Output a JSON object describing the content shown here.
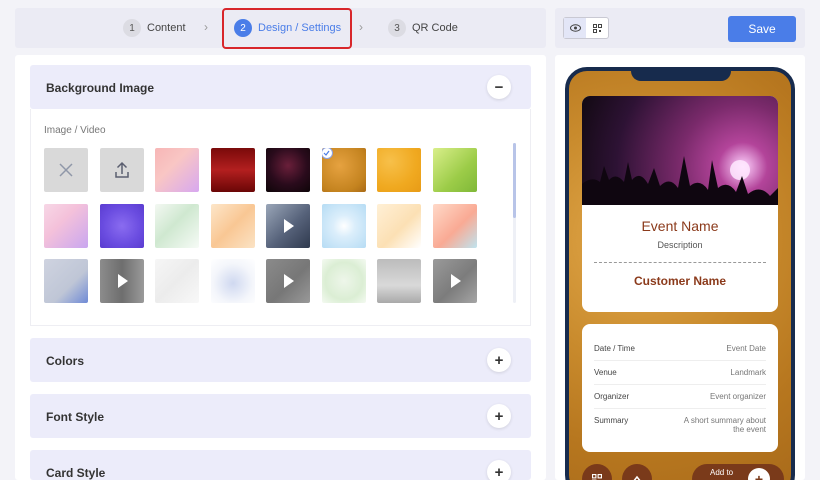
{
  "stepper": {
    "steps": [
      {
        "num": "1",
        "label": "Content"
      },
      {
        "num": "2",
        "label": "Design / Settings"
      },
      {
        "num": "3",
        "label": "QR Code"
      }
    ]
  },
  "panels": {
    "background_image": {
      "title": "Background Image",
      "toggle": "−",
      "sub_label": "Image / Video"
    },
    "colors": {
      "title": "Colors",
      "toggle": "+"
    },
    "font_style": {
      "title": "Font Style",
      "toggle": "+"
    },
    "card_style": {
      "title": "Card Style",
      "toggle": "+"
    }
  },
  "thumbnails": [
    {
      "kind": "none",
      "bg": "#d9d9d9"
    },
    {
      "kind": "upload",
      "bg": "#d9d9d9"
    },
    {
      "kind": "image",
      "bg": "linear-gradient(135deg,#f7b6b6,#f9c6c4 40%,#d7a8f0)"
    },
    {
      "kind": "image",
      "bg": "linear-gradient(180deg,#7a0a0a,#b31f1f 50%,#6a0606)"
    },
    {
      "kind": "image",
      "bg": "radial-gradient(circle at 50% 40%,#6a1f3a,#2a0b1c 55%,#0e0508)"
    },
    {
      "kind": "image",
      "bg": "radial-gradient(circle at 40% 40%,#e6a240,#c4831f 70%,#a96a16)",
      "selected": true
    },
    {
      "kind": "image",
      "bg": "radial-gradient(circle at 30% 30%,#f7c04a,#f0a920 60%,#e89b16)"
    },
    {
      "kind": "image",
      "bg": "linear-gradient(135deg,#d9ef8a,#9ccc48 60%,#7fb838)"
    },
    {
      "kind": "image",
      "bg": "linear-gradient(135deg,#f7d7e6,#f4c1da 40%,#c9a6f0)"
    },
    {
      "kind": "image",
      "bg": "radial-gradient(circle at 50% 50%,#8a6cf0,#6a4ce0 60%,#5a3cd0)"
    },
    {
      "kind": "image",
      "bg": "linear-gradient(135deg,#f3f8f2,#cfe8d0 45%,#f6fbf6)"
    },
    {
      "kind": "image",
      "bg": "linear-gradient(135deg,#fde6c9,#f9c794 50%,#fbe3c5)"
    },
    {
      "kind": "video",
      "bg": "linear-gradient(135deg,#9aa6b8,#56627a 55%,#2f3a4e)"
    },
    {
      "kind": "image",
      "bg": "radial-gradient(circle at 50% 50%,#ffffff,#dbeefb 35%,#b6dcf4)"
    },
    {
      "kind": "image",
      "bg": "linear-gradient(135deg,#fff0d6,#fce0b4 55%,#ffffff)"
    },
    {
      "kind": "image",
      "bg": "linear-gradient(135deg,#ffd9c8,#f9aa94 55%,#bfe4ef)"
    },
    {
      "kind": "image",
      "bg": "linear-gradient(135deg,#cfd3e0,#bfc6d6 60%,#6f8ad6)"
    },
    {
      "kind": "video",
      "bg": "linear-gradient(90deg,#8c8c8c,#6e6e6e 50%,#9a9a9a)"
    },
    {
      "kind": "image",
      "bg": "linear-gradient(135deg,#f6f6f6,#ececec 50%,#f8f8f8)"
    },
    {
      "kind": "image",
      "bg": "radial-gradient(circle at 50% 55%,#cfd8f0,#f4f6fb 60%,#ffffff)"
    },
    {
      "kind": "video",
      "bg": "linear-gradient(135deg,#8b8b8b,#777 55%,#999)"
    },
    {
      "kind": "image",
      "bg": "radial-gradient(circle at 50% 50%,#eef6ea,#dbeed4 60%,#f4faf1)"
    },
    {
      "kind": "image",
      "bg": "linear-gradient(180deg,#bcbcbc,#d9d9d9 60%,#a9a9a9)"
    },
    {
      "kind": "video",
      "bg": "linear-gradient(135deg,#9a9a9a,#7c7c7c 55%,#a5a5a5)"
    }
  ],
  "toolbar": {
    "save_label": "Save",
    "preview_icon": "eye-icon",
    "qr_icon": "qr-icon"
  },
  "preview": {
    "event_name": "Event Name",
    "description": "Description",
    "customer_name": "Customer Name",
    "details": [
      {
        "key": "Date / Time",
        "value": "Event Date"
      },
      {
        "key": "Venue",
        "value": "Landmark"
      },
      {
        "key": "Organizer",
        "value": "Event organizer"
      },
      {
        "key": "Summary",
        "value": "A short summary about the event"
      }
    ],
    "add_to": "Add to"
  }
}
